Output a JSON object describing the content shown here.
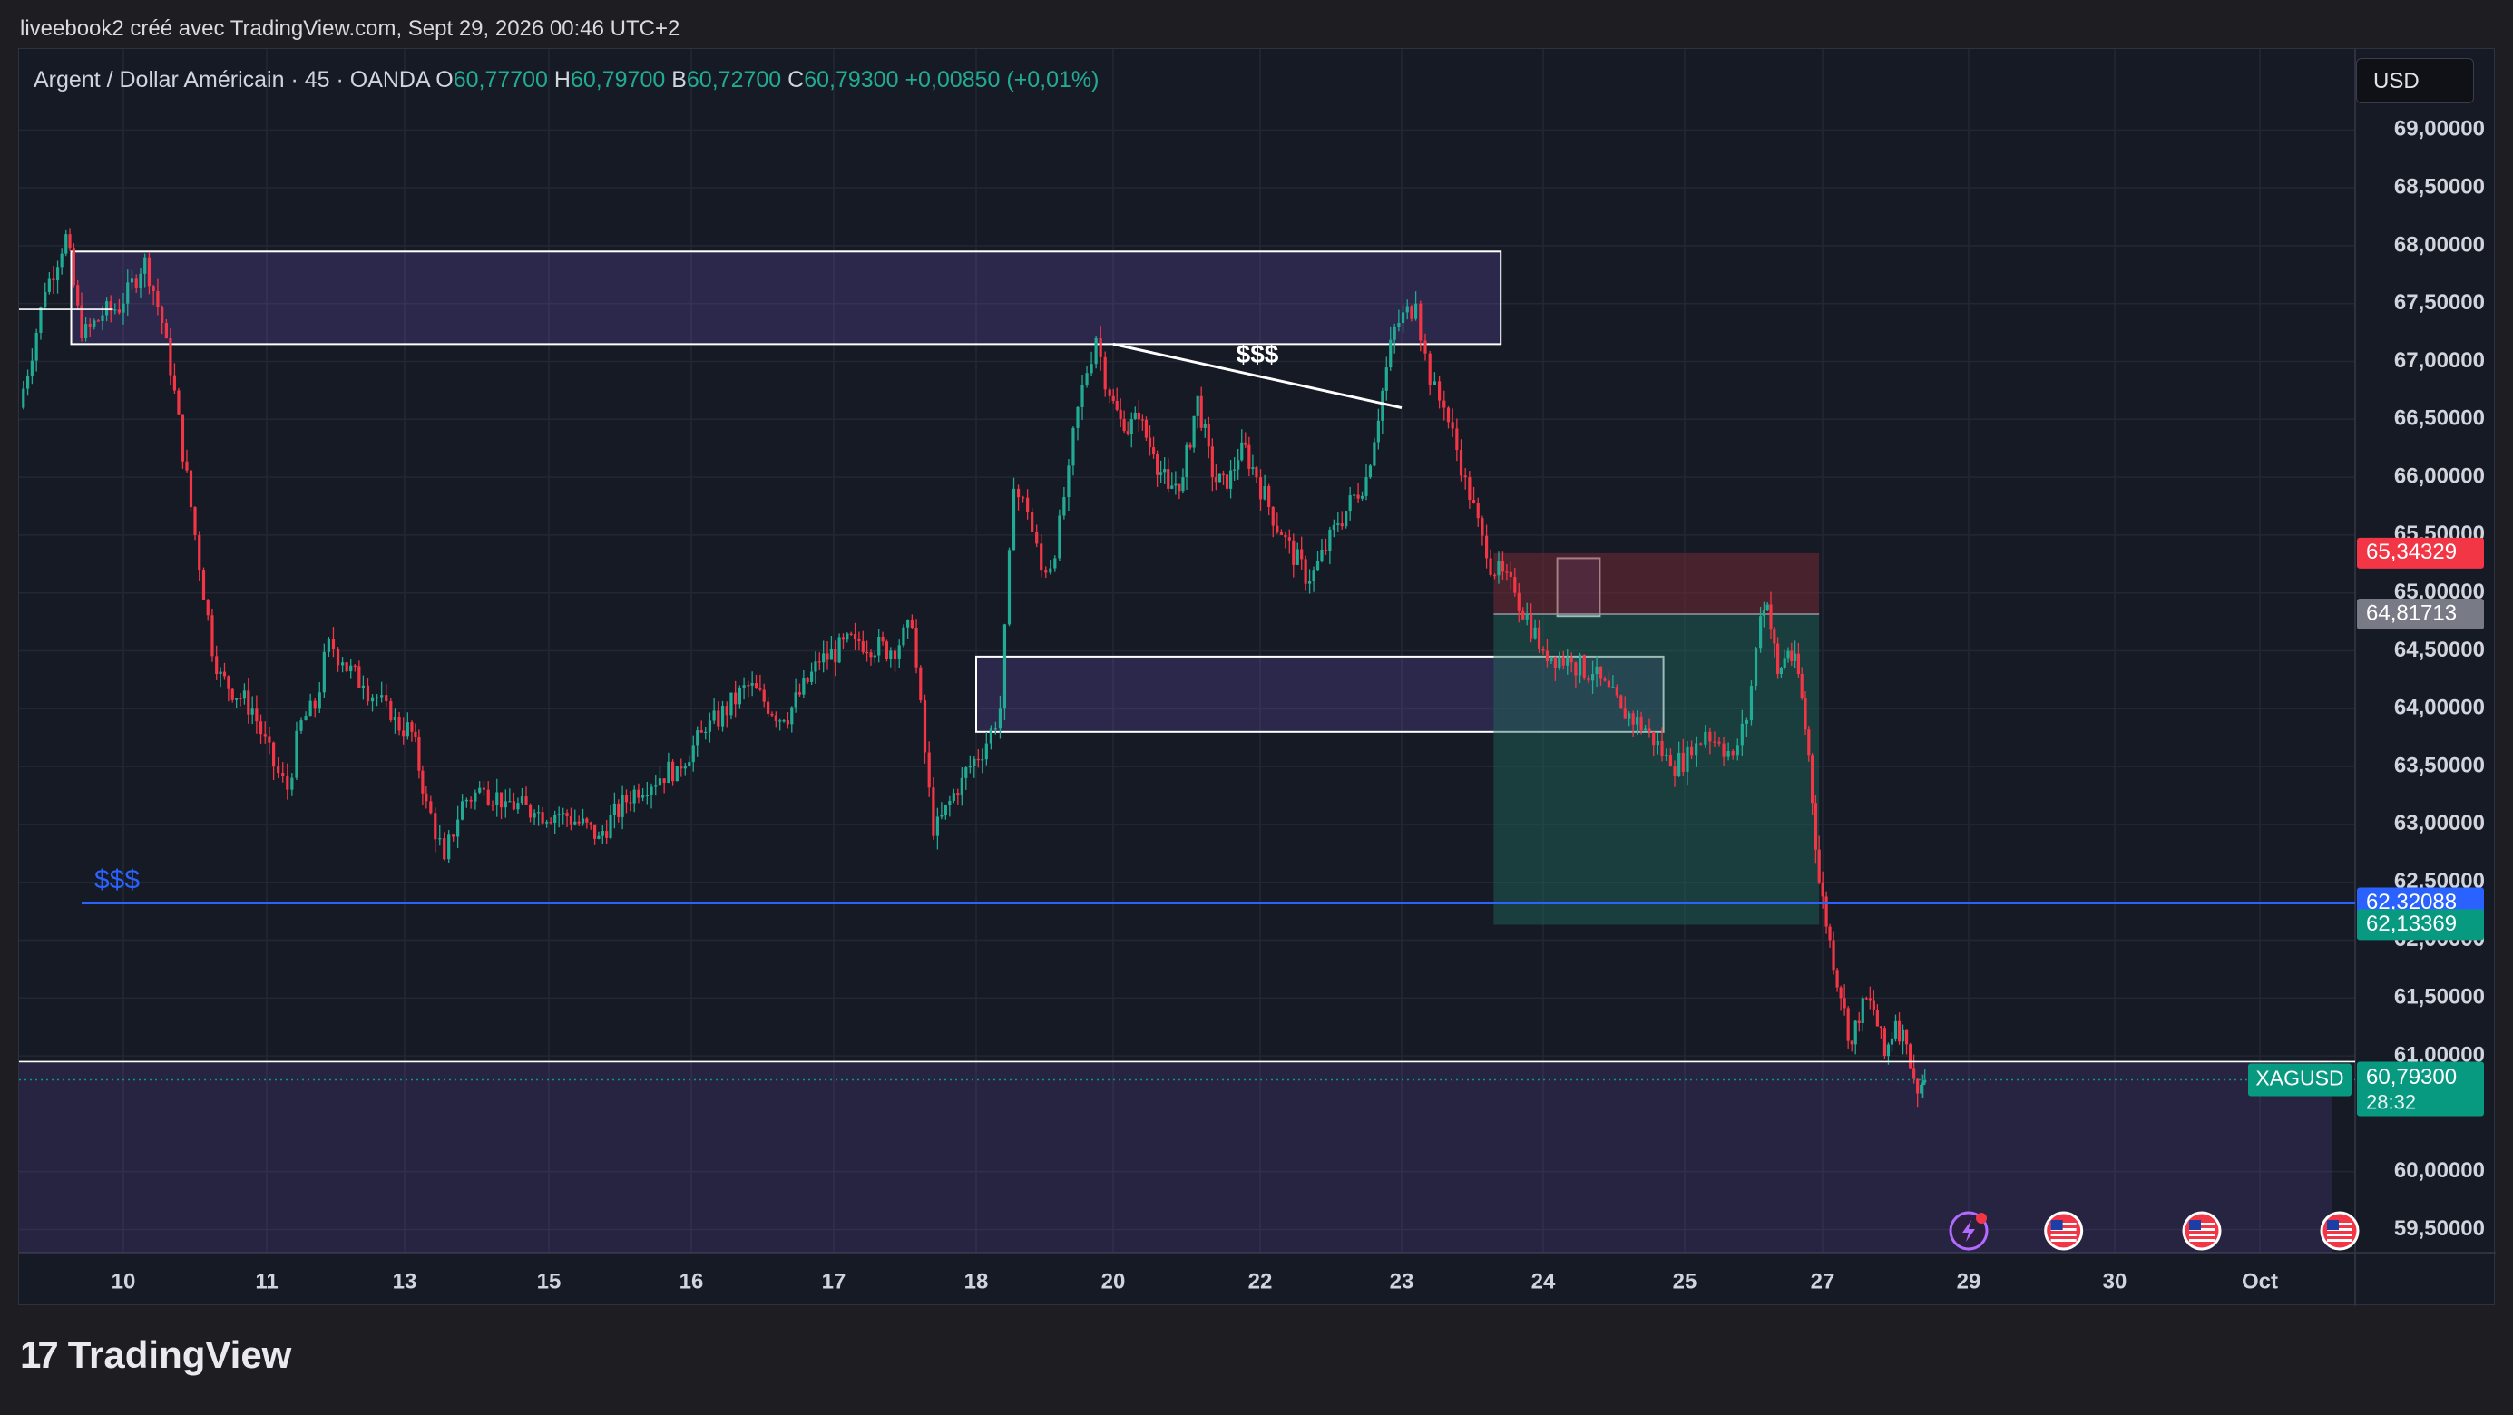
{
  "header": {
    "caption": "liveebook2 créé avec TradingView.com, Sept 29, 2026 00:46 UTC+2"
  },
  "legend": {
    "symbol": "Argent / Dollar Américain · 45 · OANDA",
    "o_key": "O",
    "o": "60,77700",
    "h_key": "H",
    "h": "60,79700",
    "b_key": "B",
    "b": "60,72700",
    "c_key": "C",
    "c": "60,79300",
    "change": "+0,00850 (+0,01%)"
  },
  "currency_button": "USD",
  "footer": {
    "logo_mark": "17",
    "logo_text": "TradingView"
  },
  "colors": {
    "up": "#22ab94",
    "down": "#f23645",
    "zone": "#7b5cd6",
    "blue_line": "#2962ff",
    "background": "#161a25",
    "target": "#1f6b5c",
    "stop": "#6b2a33"
  },
  "icons": [
    "lightning-icon",
    "us-flag-icon",
    "us-flag-icon",
    "us-flag-icon"
  ],
  "chart_data": {
    "type": "candlestick",
    "symbol": "XAGUSD",
    "timeframe": "45",
    "y_range": [
      59.3,
      69.7
    ],
    "x_ticks": [
      "10",
      "11",
      "13",
      "15",
      "16",
      "17",
      "18",
      "20",
      "22",
      "23",
      "24",
      "25",
      "27",
      "29",
      "30",
      "Oct"
    ],
    "y_ticks": [
      {
        "value": 69.0,
        "label": "69,00000"
      },
      {
        "value": 68.5,
        "label": "68,50000"
      },
      {
        "value": 68.0,
        "label": "68,00000"
      },
      {
        "value": 67.5,
        "label": "67,50000"
      },
      {
        "value": 67.0,
        "label": "67,00000"
      },
      {
        "value": 66.5,
        "label": "66,50000"
      },
      {
        "value": 66.0,
        "label": "66,00000"
      },
      {
        "value": 65.5,
        "label": "65,50000"
      },
      {
        "value": 65.0,
        "label": "65,00000"
      },
      {
        "value": 64.5,
        "label": "64,50000"
      },
      {
        "value": 64.0,
        "label": "64,00000"
      },
      {
        "value": 63.5,
        "label": "63,50000"
      },
      {
        "value": 63.0,
        "label": "63,00000"
      },
      {
        "value": 62.5,
        "label": "62,50000"
      },
      {
        "value": 62.0,
        "label": "62,00000"
      },
      {
        "value": 61.5,
        "label": "61,50000"
      },
      {
        "value": 61.0,
        "label": "61,00000"
      },
      {
        "value": 60.0,
        "label": "60,00000"
      },
      {
        "value": 59.5,
        "label": "59,50000"
      }
    ],
    "price_path": [
      [
        9.0,
        66.6
      ],
      [
        9.25,
        67.6
      ],
      [
        9.45,
        68.1
      ],
      [
        9.6,
        67.2
      ],
      [
        9.8,
        67.4
      ],
      [
        10.0,
        67.5
      ],
      [
        10.15,
        67.9
      ],
      [
        10.3,
        67.2
      ],
      [
        10.5,
        65.5
      ],
      [
        10.65,
        64.3
      ],
      [
        10.9,
        64.0
      ],
      [
        11.1,
        63.5
      ],
      [
        11.3,
        63.3
      ],
      [
        11.5,
        63.9
      ],
      [
        11.7,
        64.0
      ],
      [
        11.9,
        64.6
      ],
      [
        12.1,
        64.4
      ],
      [
        12.4,
        64.2
      ],
      [
        12.6,
        64.1
      ],
      [
        12.8,
        63.9
      ],
      [
        13.1,
        63.8
      ],
      [
        13.3,
        63.2
      ],
      [
        13.55,
        62.7
      ],
      [
        13.8,
        63.2
      ],
      [
        14.1,
        63.3
      ],
      [
        14.4,
        63.2
      ],
      [
        14.8,
        63.1
      ],
      [
        15.1,
        63.1
      ],
      [
        15.35,
        62.9
      ],
      [
        15.6,
        63.3
      ],
      [
        15.9,
        63.5
      ],
      [
        16.1,
        63.8
      ],
      [
        16.4,
        64.2
      ],
      [
        16.65,
        63.9
      ],
      [
        16.9,
        64.4
      ],
      [
        17.15,
        64.6
      ],
      [
        17.4,
        64.5
      ],
      [
        17.55,
        64.7
      ],
      [
        17.7,
        62.9
      ],
      [
        17.9,
        63.4
      ],
      [
        18.15,
        63.7
      ],
      [
        18.35,
        64.0
      ],
      [
        18.55,
        65.9
      ],
      [
        18.75,
        65.7
      ],
      [
        18.95,
        65.2
      ],
      [
        19.15,
        65.3
      ],
      [
        19.35,
        66.1
      ],
      [
        19.55,
        66.8
      ],
      [
        19.75,
        67.2
      ],
      [
        19.95,
        66.7
      ],
      [
        20.15,
        66.4
      ],
      [
        20.35,
        66.5
      ],
      [
        20.55,
        66.2
      ],
      [
        20.75,
        65.9
      ],
      [
        20.95,
        66.0
      ],
      [
        21.15,
        66.7
      ],
      [
        21.35,
        66.0
      ],
      [
        21.55,
        65.9
      ],
      [
        21.75,
        66.3
      ],
      [
        21.95,
        66.0
      ],
      [
        22.15,
        65.5
      ],
      [
        22.35,
        65.1
      ],
      [
        22.55,
        65.6
      ],
      [
        22.75,
        66.0
      ],
      [
        22.95,
        67.3
      ],
      [
        23.1,
        67.5
      ],
      [
        23.2,
        66.8
      ],
      [
        23.3,
        66.6
      ],
      [
        23.45,
        66.0
      ],
      [
        23.6,
        65.3
      ],
      [
        23.8,
        65.0
      ],
      [
        24.0,
        64.5
      ],
      [
        24.2,
        64.4
      ],
      [
        24.35,
        64.3
      ],
      [
        24.55,
        64.0
      ],
      [
        24.75,
        63.8
      ],
      [
        24.9,
        63.5
      ],
      [
        25.1,
        63.6
      ],
      [
        25.3,
        63.8
      ],
      [
        25.5,
        63.7
      ],
      [
        25.7,
        63.6
      ],
      [
        25.9,
        63.9
      ],
      [
        26.1,
        64.8
      ],
      [
        26.2,
        64.9
      ],
      [
        26.35,
        64.3
      ],
      [
        26.5,
        64.5
      ],
      [
        26.65,
        64.3
      ],
      [
        26.8,
        63.6
      ],
      [
        26.95,
        62.5
      ],
      [
        27.1,
        62.0
      ],
      [
        27.25,
        61.5
      ],
      [
        27.4,
        61.1
      ],
      [
        27.55,
        61.5
      ],
      [
        27.7,
        61.4
      ],
      [
        27.85,
        61.0
      ],
      [
        28.0,
        61.3
      ],
      [
        28.15,
        61.1
      ],
      [
        28.25,
        60.8
      ],
      [
        28.35,
        60.75
      ],
      [
        28.4,
        60.79
      ]
    ],
    "annotations": [
      {
        "type": "rectangle",
        "x": [
          9.5,
          23.7
        ],
        "y": [
          67.15,
          67.95
        ],
        "color": "#7b5cd6"
      },
      {
        "type": "rectangle",
        "x": [
          18.0,
          24.85
        ],
        "y": [
          63.8,
          64.45
        ],
        "color": "#7b5cd6"
      },
      {
        "type": "rectangle",
        "x": [
          24.1,
          24.4
        ],
        "y": [
          64.8,
          65.3
        ],
        "color": "#7b5cd6"
      },
      {
        "type": "rectangle",
        "x": [
          8.9,
          31.5
        ],
        "y": [
          59.3,
          60.95
        ],
        "color": "#7b5cd6"
      },
      {
        "type": "trendline",
        "x": [
          20.0,
          23.0
        ],
        "y": [
          67.15,
          66.6
        ],
        "label": "$$$"
      },
      {
        "type": "hline",
        "y": 62.32088,
        "x_start": 9.6,
        "label": "$$$",
        "color": "#2962ff"
      },
      {
        "type": "hline",
        "y": 60.95,
        "color": "#ffffff"
      },
      {
        "type": "hline",
        "y": 67.45,
        "x_end": 9.9,
        "color": "#ffffff"
      },
      {
        "type": "position",
        "x": [
          23.65,
          26.95
        ],
        "entry": 64.81713,
        "stop": 65.34329,
        "target": 62.13369
      }
    ],
    "price_labels": [
      {
        "value": 65.34329,
        "label": "65,34329",
        "color": "#f23645"
      },
      {
        "value": 64.81713,
        "label": "64,81713",
        "color": "#787b86"
      },
      {
        "value": 62.32088,
        "label": "62,32088",
        "color": "#2962ff"
      },
      {
        "value": 62.13369,
        "label": "62,13369",
        "color": "#089981"
      },
      {
        "value": 60.793,
        "label": "60,79300",
        "color": "#089981",
        "symbol": "XAGUSD",
        "countdown": "28:32"
      }
    ]
  }
}
